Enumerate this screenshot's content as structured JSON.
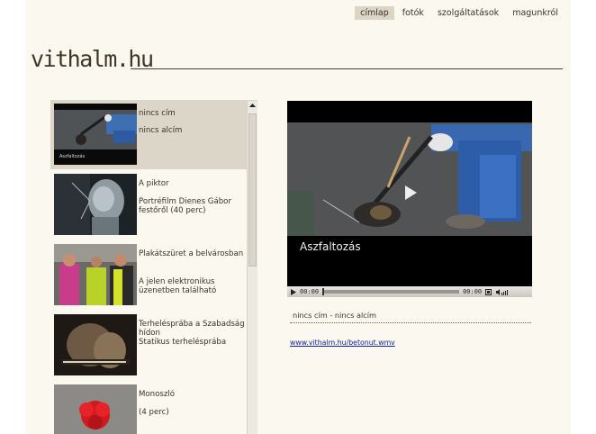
{
  "nav": {
    "items": [
      "címlap",
      "fotók",
      "szolgáltatások",
      "magunkról"
    ]
  },
  "logo": "vithalm.hu",
  "videos": [
    {
      "title": "nincs cím",
      "subtitle": "nincs alcím",
      "thumb_caption": "Aszfaltozás",
      "selected": true
    },
    {
      "title": "A piktor",
      "subtitle": "Portréfilm Dienes Gábor festőről (40 perc)"
    },
    {
      "title": "Plakátszüret a belvárosban",
      "subtitle": "A jelen elektronikus üzenetben található"
    },
    {
      "title": "Terhelésprába a Szabadság hídon",
      "subtitle": "Statikus terhelésprába"
    },
    {
      "title": "Monoszló",
      "subtitle": "(4 perc)"
    }
  ],
  "player": {
    "overlay_text": "Aszfaltozás",
    "time_elapsed": "00:00",
    "time_total": "00:00"
  },
  "caption": "nincs cím - nincs alcím",
  "file_link": "www.vithalm.hu/betonut.wmv",
  "colors": {
    "background": "#fbf8ef",
    "selected_item": "#dbd6c8",
    "active_nav": "#dcd5c5",
    "link": "#0f1ea8"
  }
}
